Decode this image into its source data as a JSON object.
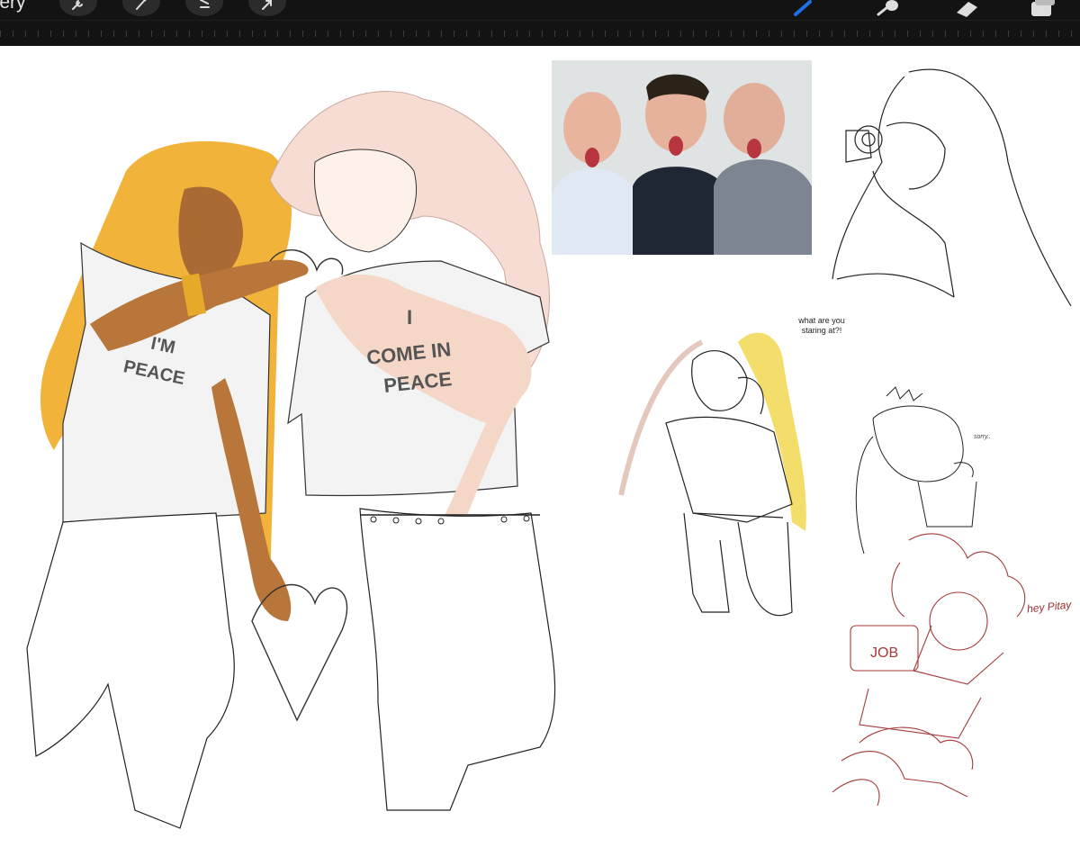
{
  "toolbar": {
    "gallery_label": "llery",
    "left_tools": [
      "wrench-icon",
      "magic-wand-icon",
      "selection-icon",
      "transform-arrow-icon"
    ],
    "right_tools": [
      "brush-icon",
      "smudge-icon",
      "eraser-icon",
      "layers-icon"
    ],
    "active_tool_color": "#1f6fe6"
  },
  "canvas": {
    "shirt_left_text": "I'M PEACE",
    "shirt_left_line1": "I'M",
    "shirt_left_line2": "PEACE",
    "shirt_right_line1": "I",
    "shirt_right_line2": "COME IN",
    "shirt_right_line3": "PEACE",
    "speech_line1": "what are you",
    "speech_line2": "staring at?!",
    "sorry_text": "sorry..",
    "hey_text": "hey Pitay",
    "job_sign": "JOB",
    "ink_color": "#222222",
    "red_ink_color": "#a43a3a",
    "hair_gold": "#f2b33a",
    "skin_brown": "#b8763a"
  }
}
